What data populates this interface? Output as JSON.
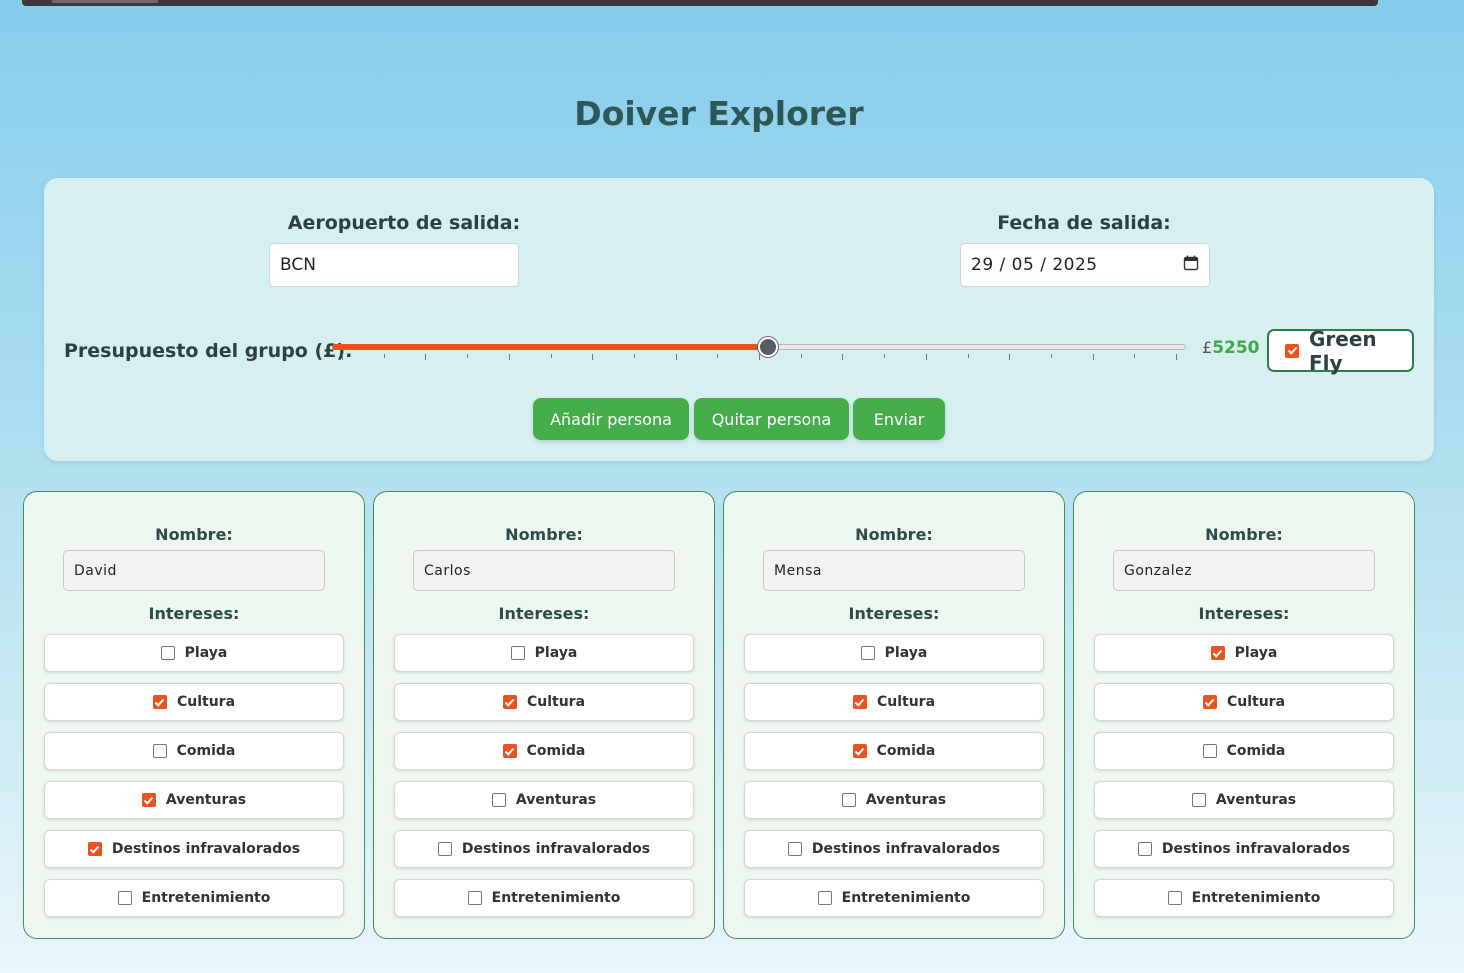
{
  "app_title": "Doiver Explorer",
  "departure_airport": {
    "label": "Aeropuerto de salida:",
    "value": "BCN"
  },
  "departure_date": {
    "label": "Fecha de salida:",
    "value": "29 / 05 / 2025"
  },
  "budget": {
    "label": "Presupuesto del grupo (£):",
    "currency": "£",
    "value": "5250",
    "fraction": 0.51
  },
  "green_fly": {
    "label": "Green Fly",
    "checked": true
  },
  "buttons": {
    "add_person": "Añadir persona",
    "remove_person": "Quitar persona",
    "submit": "Enviar"
  },
  "person_labels": {
    "name": "Nombre:",
    "interests": "Intereses:"
  },
  "persons": [
    {
      "name": "David",
      "interests": [
        {
          "label": "Playa",
          "checked": false
        },
        {
          "label": "Cultura",
          "checked": true
        },
        {
          "label": "Comida",
          "checked": false
        },
        {
          "label": "Aventuras",
          "checked": true
        },
        {
          "label": "Destinos infravalorados",
          "checked": true
        },
        {
          "label": "Entretenimiento",
          "checked": false
        }
      ]
    },
    {
      "name": "Carlos",
      "interests": [
        {
          "label": "Playa",
          "checked": false
        },
        {
          "label": "Cultura",
          "checked": true
        },
        {
          "label": "Comida",
          "checked": true
        },
        {
          "label": "Aventuras",
          "checked": false
        },
        {
          "label": "Destinos infravalorados",
          "checked": false
        },
        {
          "label": "Entretenimiento",
          "checked": false
        }
      ]
    },
    {
      "name": "Mensa",
      "interests": [
        {
          "label": "Playa",
          "checked": false
        },
        {
          "label": "Cultura",
          "checked": true
        },
        {
          "label": "Comida",
          "checked": true
        },
        {
          "label": "Aventuras",
          "checked": false
        },
        {
          "label": "Destinos infravalorados",
          "checked": false
        },
        {
          "label": "Entretenimiento",
          "checked": false
        }
      ]
    },
    {
      "name": "Gonzalez",
      "interests": [
        {
          "label": "Playa",
          "checked": true
        },
        {
          "label": "Cultura",
          "checked": true
        },
        {
          "label": "Comida",
          "checked": false
        },
        {
          "label": "Aventuras",
          "checked": false
        },
        {
          "label": "Destinos infravalorados",
          "checked": false
        },
        {
          "label": "Entretenimiento",
          "checked": false
        }
      ]
    }
  ],
  "colors": {
    "accent": "#e8531f",
    "button": "#45ad4a",
    "card_border": "#3f8f5f",
    "title": "#2e5758"
  }
}
